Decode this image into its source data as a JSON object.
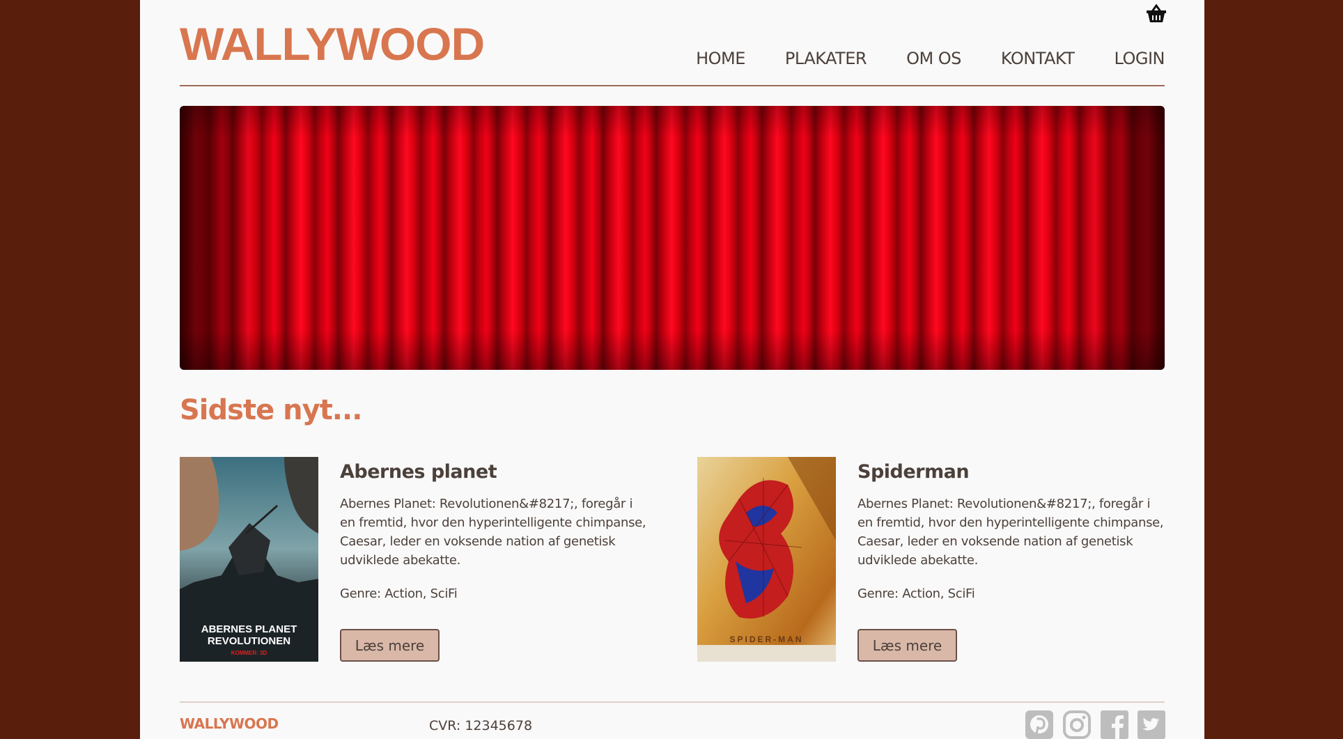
{
  "header": {
    "logo": "WALLYWOOD",
    "nav": [
      "HOME",
      "PLAKATER",
      "OM OS",
      "KONTAKT",
      "LOGIN"
    ],
    "cart_icon": "basket-icon"
  },
  "hero": {
    "image": "red-theater-curtain"
  },
  "news": {
    "title": "Sidste nyt...",
    "items": [
      {
        "title": "Abernes planet",
        "description": "Abernes Planet: Revolutionen&#8217;, foregår i en fremtid, hvor den hyperintelligente chimpanse, Caesar, leder en voksende nation af genetisk udviklede abekatte.",
        "genre": "Genre: Action, SciFi",
        "button": "Læs mere",
        "poster_title": "ABERNES PLANET\nREVOLUTIONEN",
        "poster_tagline": "KOMMER: 3D"
      },
      {
        "title": "Spiderman",
        "description": "Abernes Planet: Revolutionen&#8217;, foregår i en fremtid, hvor den hyperintelligente chimpanse, Caesar, leder en voksende nation af genetisk udviklede abekatte.",
        "genre": "Genre: Action, SciFi",
        "button": "Læs mere",
        "poster_title": "SPIDER-MAN"
      }
    ]
  },
  "footer": {
    "logo": "WALLYWOOD",
    "cvr": "CVR: 12345678",
    "social_icons": [
      "pinterest-icon",
      "instagram-icon",
      "facebook-icon",
      "twitter-icon"
    ],
    "icon_color": "#bdbdbd"
  },
  "colors": {
    "background": "#5a1e0c",
    "page": "#f9f9f9",
    "accent": "#d8764f",
    "text": "#4c403a",
    "button_bg": "#d9b8a8"
  }
}
